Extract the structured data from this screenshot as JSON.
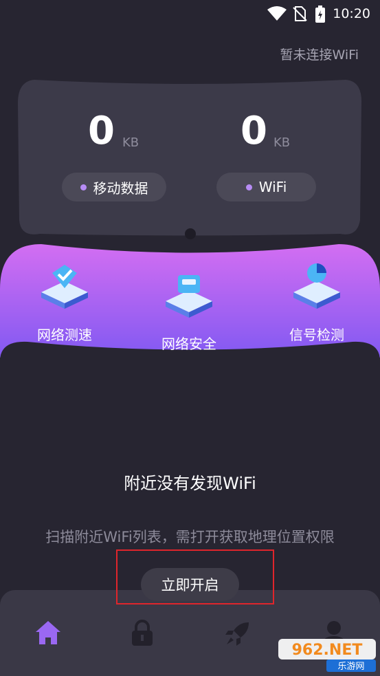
{
  "status_bar": {
    "time": "10:20"
  },
  "header": {
    "wifi_status": "暂未连接WiFi"
  },
  "usage": {
    "mobile": {
      "value": "0",
      "unit": "KB",
      "label": "移动数据"
    },
    "wifi": {
      "value": "0",
      "unit": "KB",
      "label": "WiFi"
    }
  },
  "features": [
    {
      "label": "网络测速",
      "icon": "speed-test-icon"
    },
    {
      "label": "网络安全",
      "icon": "network-security-icon"
    },
    {
      "label": "信号检测",
      "icon": "signal-detect-icon"
    }
  ],
  "empty_state": {
    "title": "附近没有发现WiFi",
    "description": "扫描附近WiFi列表，需打开获取地理位置权限",
    "button_label": "立即开启"
  },
  "bottom_nav": [
    {
      "icon": "home-icon",
      "active": true
    },
    {
      "icon": "lock-icon",
      "active": false
    },
    {
      "icon": "rocket-icon",
      "active": false
    },
    {
      "icon": "profile-icon",
      "active": false
    }
  ],
  "watermark": {
    "text_top": "962.NET",
    "text_bottom": "乐游网"
  },
  "colors": {
    "background": "#272531",
    "card": "#3c3a49",
    "accent_purple": "#8a57f0",
    "accent_pink": "#d36ef2",
    "highlight_red": "#e0252b"
  }
}
